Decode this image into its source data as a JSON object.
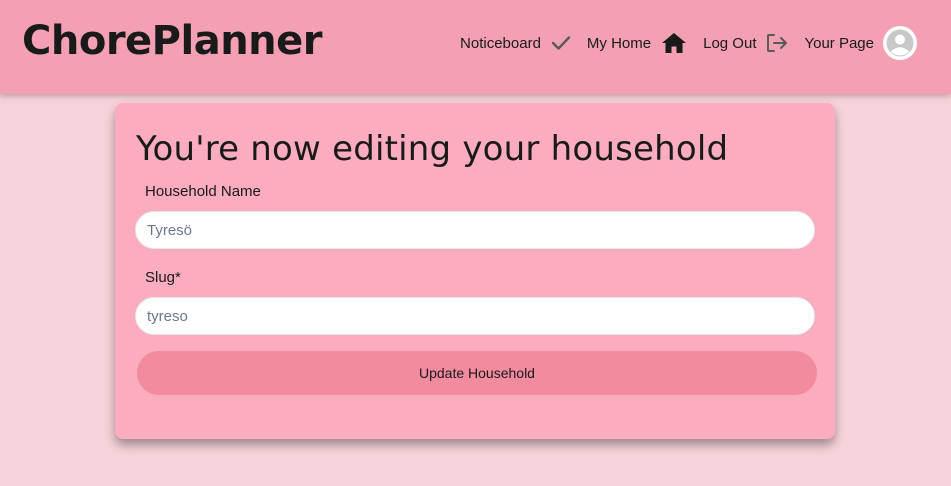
{
  "header": {
    "brand": "ChorePlanner",
    "nav": [
      {
        "label": "Noticeboard",
        "icon": "check-icon"
      },
      {
        "label": "My Home",
        "icon": "home-icon"
      },
      {
        "label": "Log Out",
        "icon": "logout-icon"
      },
      {
        "label": "Your Page",
        "icon": "avatar-icon"
      }
    ]
  },
  "form": {
    "title": "You're now editing your household",
    "household_name_label": "Household Name",
    "household_name_placeholder": "Tyresö",
    "slug_label": "Slug*",
    "slug_placeholder": "tyreso",
    "submit_label": "Update Household"
  },
  "colors": {
    "page_bg": "#f6d3da",
    "header_bg": "#f3a0b2",
    "card_bg": "#fbacbe",
    "button_bg": "#f28b9d"
  }
}
